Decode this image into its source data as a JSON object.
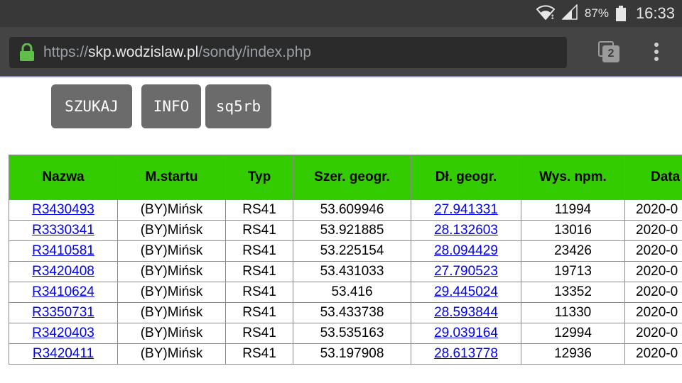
{
  "statusbar": {
    "battery": "87%",
    "clock": "16:33"
  },
  "browser": {
    "url_scheme": "https://",
    "url_host": "skp.wodzislaw.pl",
    "url_path": "/sondy/index.php",
    "tab_count": "2"
  },
  "buttons": {
    "search": "SZUKAJ",
    "info": "INFO",
    "callsign": "sq5rb"
  },
  "table": {
    "headers": [
      "Nazwa",
      "M.startu",
      "Typ",
      "Szer. geogr.",
      "Dł. geogr.",
      "Wys. npm.",
      "Data"
    ],
    "rows": [
      [
        "R3430493",
        "(BY)Mińsk",
        "RS41",
        "53.609946",
        "27.941331",
        "11994",
        "2020-0"
      ],
      [
        "R3330341",
        "(BY)Mińsk",
        "RS41",
        "53.921885",
        "28.132603",
        "13016",
        "2020-0"
      ],
      [
        "R3410581",
        "(BY)Mińsk",
        "RS41",
        "53.225154",
        "28.094429",
        "23426",
        "2020-0"
      ],
      [
        "R3420408",
        "(BY)Mińsk",
        "RS41",
        "53.431033",
        "27.790523",
        "19713",
        "2020-0"
      ],
      [
        "R3410624",
        "(BY)Mińsk",
        "RS41",
        "53.416",
        "29.445024",
        "13352",
        "2020-0"
      ],
      [
        "R3350731",
        "(BY)Mińsk",
        "RS41",
        "53.433738",
        "28.593844",
        "11330",
        "2020-0"
      ],
      [
        "R3420403",
        "(BY)Mińsk",
        "RS41",
        "53.535163",
        "29.039164",
        "12994",
        "2020-0"
      ],
      [
        "R3420411",
        "(BY)Mińsk",
        "RS41",
        "53.197908",
        "28.613778",
        "12936",
        "2020-0"
      ]
    ]
  },
  "colors": {
    "header_bg": "#33cc00",
    "button_bg": "#6b6b6b",
    "link": "#0000ee"
  },
  "icons": [
    "wifi-icon",
    "signal-icon",
    "battery-icon",
    "lock-icon",
    "tabs-icon",
    "menu-icon"
  ]
}
